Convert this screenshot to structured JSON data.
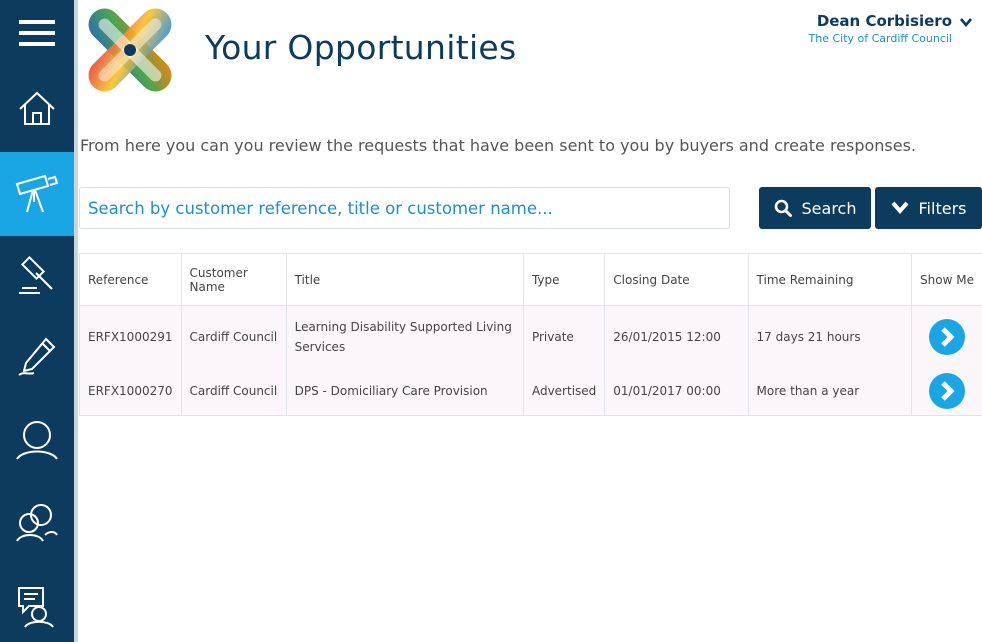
{
  "header": {
    "title": "Your Opportunities",
    "user_name": "Dean Corbisiero",
    "user_org": "The City of Cardiff Council"
  },
  "intro": "From here you can you review the requests that have been sent to you by buyers and create responses.",
  "search": {
    "placeholder": "Search by customer reference, title or customer name...",
    "search_label": "Search",
    "filters_label": "Filters"
  },
  "sidebar": {
    "items": [
      {
        "icon": "menu-icon"
      },
      {
        "icon": "home-icon"
      },
      {
        "icon": "telescope-icon",
        "active": true
      },
      {
        "icon": "gavel-icon"
      },
      {
        "icon": "pen-icon"
      },
      {
        "icon": "user-icon"
      },
      {
        "icon": "users-icon"
      },
      {
        "icon": "chat-user-icon"
      }
    ]
  },
  "table": {
    "headers": [
      "Reference",
      "Customer Name",
      "Title",
      "Type",
      "Closing Date",
      "Time Remaining",
      "Show Me"
    ],
    "rows": [
      {
        "reference": "ERFX1000291",
        "customer": "Cardiff Council",
        "title": "Learning Disability Supported Living Services",
        "type": "Private",
        "closing": "26/01/2015 12:00",
        "remaining": "17 days 21 hours"
      },
      {
        "reference": "ERFX1000270",
        "customer": "Cardiff Council",
        "title": "DPS - Domiciliary Care Provision",
        "type": "Advertised",
        "closing": "01/01/2017 00:00",
        "remaining": "More than a year"
      }
    ]
  },
  "colors": {
    "navy": "#0d3b5e",
    "accent": "#1aa6e4",
    "link": "#1a8fd0"
  }
}
